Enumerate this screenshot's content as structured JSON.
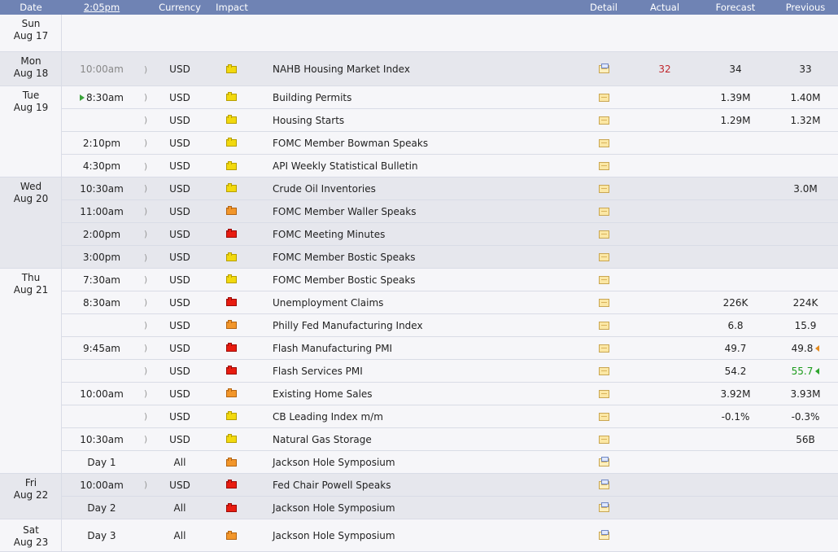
{
  "header": {
    "date": "Date",
    "time": "2:05pm",
    "currency": "Currency",
    "impact": "Impact",
    "detail": "Detail",
    "actual": "Actual",
    "forecast": "Forecast",
    "previous": "Previous"
  },
  "days": [
    {
      "dow": "Sun",
      "date": "Aug 17"
    },
    {
      "dow": "Mon",
      "date": "Aug 18"
    },
    {
      "dow": "Tue",
      "date": "Aug 19"
    },
    {
      "dow": "Wed",
      "date": "Aug 20"
    },
    {
      "dow": "Thu",
      "date": "Aug 21"
    },
    {
      "dow": "Fri",
      "date": "Aug 22"
    },
    {
      "dow": "Sat",
      "date": "Aug 23"
    }
  ],
  "events": [
    {
      "time": "10:00am",
      "currency": "USD",
      "impact": "low",
      "event": "NAHB Housing Market Index",
      "actual": "32",
      "forecast": "34",
      "previous": "33"
    },
    {
      "time": "8:30am",
      "currency": "USD",
      "impact": "low",
      "event": "Building Permits",
      "actual": "",
      "forecast": "1.39M",
      "previous": "1.40M"
    },
    {
      "time": "",
      "currency": "USD",
      "impact": "low",
      "event": "Housing Starts",
      "actual": "",
      "forecast": "1.29M",
      "previous": "1.32M"
    },
    {
      "time": "2:10pm",
      "currency": "USD",
      "impact": "low",
      "event": "FOMC Member Bowman Speaks",
      "actual": "",
      "forecast": "",
      "previous": ""
    },
    {
      "time": "4:30pm",
      "currency": "USD",
      "impact": "low",
      "event": "API Weekly Statistical Bulletin",
      "actual": "",
      "forecast": "",
      "previous": ""
    },
    {
      "time": "10:30am",
      "currency": "USD",
      "impact": "low",
      "event": "Crude Oil Inventories",
      "actual": "",
      "forecast": "",
      "previous": "3.0M"
    },
    {
      "time": "11:00am",
      "currency": "USD",
      "impact": "medium",
      "event": "FOMC Member Waller Speaks",
      "actual": "",
      "forecast": "",
      "previous": ""
    },
    {
      "time": "2:00pm",
      "currency": "USD",
      "impact": "high",
      "event": "FOMC Meeting Minutes",
      "actual": "",
      "forecast": "",
      "previous": ""
    },
    {
      "time": "3:00pm",
      "currency": "USD",
      "impact": "low",
      "event": "FOMC Member Bostic Speaks",
      "actual": "",
      "forecast": "",
      "previous": ""
    },
    {
      "time": "7:30am",
      "currency": "USD",
      "impact": "low",
      "event": "FOMC Member Bostic Speaks",
      "actual": "",
      "forecast": "",
      "previous": ""
    },
    {
      "time": "8:30am",
      "currency": "USD",
      "impact": "high",
      "event": "Unemployment Claims",
      "actual": "",
      "forecast": "226K",
      "previous": "224K"
    },
    {
      "time": "",
      "currency": "USD",
      "impact": "medium",
      "event": "Philly Fed Manufacturing Index",
      "actual": "",
      "forecast": "6.8",
      "previous": "15.9"
    },
    {
      "time": "9:45am",
      "currency": "USD",
      "impact": "high",
      "event": "Flash Manufacturing PMI",
      "actual": "",
      "forecast": "49.7",
      "previous": "49.8"
    },
    {
      "time": "",
      "currency": "USD",
      "impact": "high",
      "event": "Flash Services PMI",
      "actual": "",
      "forecast": "54.2",
      "previous": "55.7"
    },
    {
      "time": "10:00am",
      "currency": "USD",
      "impact": "medium",
      "event": "Existing Home Sales",
      "actual": "",
      "forecast": "3.92M",
      "previous": "3.93M"
    },
    {
      "time": "",
      "currency": "USD",
      "impact": "low",
      "event": "CB Leading Index m/m",
      "actual": "",
      "forecast": "-0.1%",
      "previous": "-0.3%"
    },
    {
      "time": "10:30am",
      "currency": "USD",
      "impact": "low",
      "event": "Natural Gas Storage",
      "actual": "",
      "forecast": "",
      "previous": "56B"
    },
    {
      "time": "Day 1",
      "currency": "All",
      "impact": "medium",
      "event": "Jackson Hole Symposium",
      "actual": "",
      "forecast": "",
      "previous": ""
    },
    {
      "time": "10:00am",
      "currency": "USD",
      "impact": "high",
      "event": "Fed Chair Powell Speaks",
      "actual": "",
      "forecast": "",
      "previous": ""
    },
    {
      "time": "Day 2",
      "currency": "All",
      "impact": "high",
      "event": "Jackson Hole Symposium",
      "actual": "",
      "forecast": "",
      "previous": ""
    },
    {
      "time": "Day 3",
      "currency": "All",
      "impact": "medium",
      "event": "Jackson Hole Symposium",
      "actual": "",
      "forecast": "",
      "previous": ""
    }
  ],
  "colors": {
    "header_bg": "#6f83b4",
    "actual_red": "#c0262c",
    "previous_green": "#1a9b1a",
    "impact_low": "#f2d90e",
    "impact_medium": "#f2962a",
    "impact_high": "#e81c10"
  }
}
